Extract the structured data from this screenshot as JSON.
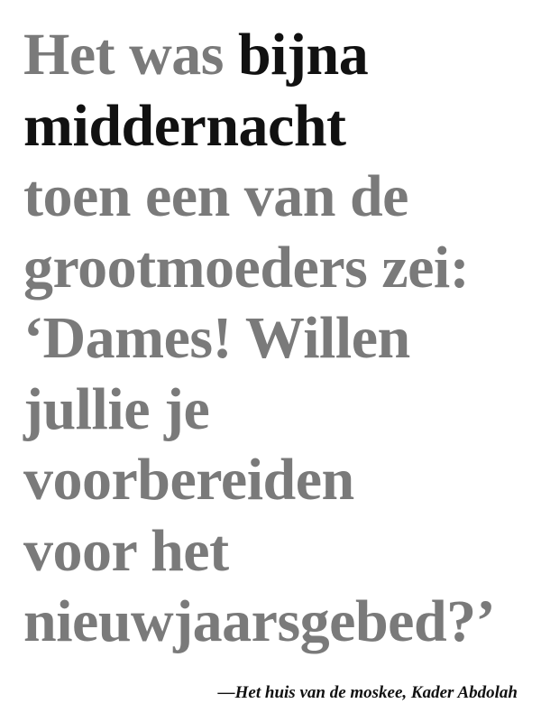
{
  "quote": {
    "line1_lead": "Het was ",
    "line1_emph": "bijna",
    "line2_emph": "middernacht",
    "line3": "toen een van de",
    "line4": "grootmoeders zei:",
    "line5": "‘Dames! Willen",
    "line6": "jullie je",
    "line7": "voorbereiden",
    "line8": "voor het",
    "line9": "nieuwjaarsgebed?’"
  },
  "attribution": {
    "text": "—Het huis van de moskee, Kader Abdolah"
  },
  "colors": {
    "body_text": "#7a7a7a",
    "emphasis_text": "#111111",
    "background": "#ffffff"
  }
}
